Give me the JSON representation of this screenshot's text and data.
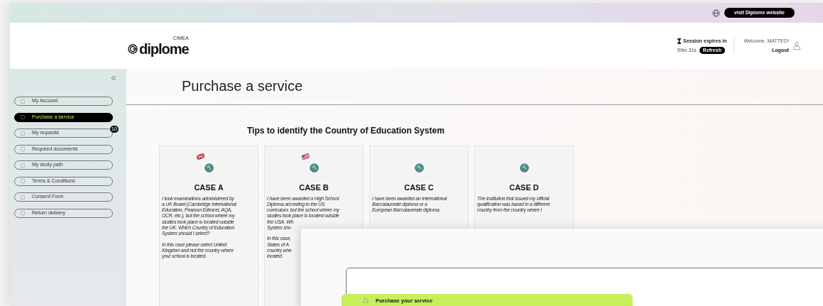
{
  "top_bar": {
    "visit_button": "visit Diplome website"
  },
  "header": {
    "logo": {
      "brand": "diplome",
      "super": "CIMEA"
    },
    "session": {
      "label": "Session expires in",
      "time": "59m 31s",
      "refresh": "Refresh"
    },
    "user": {
      "welcome": "Welcome, MATTEO!",
      "logout": "Logout"
    }
  },
  "sidebar": {
    "items": [
      {
        "label": "My Account",
        "selected": false
      },
      {
        "label": "Purchase a service",
        "selected": true
      },
      {
        "label": "My requests",
        "selected": false,
        "badge": "10"
      },
      {
        "label": "Required documents",
        "selected": false
      },
      {
        "label": "My study path",
        "selected": false
      },
      {
        "label": "Terms & Conditions",
        "selected": false
      },
      {
        "label": "Consent Form",
        "selected": false
      },
      {
        "label": "Return delivery",
        "selected": false
      }
    ]
  },
  "page": {
    "title": "Purchase a service",
    "subtitle": "Tips to identify the Country of Education System",
    "cards": [
      {
        "title": "CASE A",
        "kind": "uk",
        "paragraphs": [
          [
            "I took examinations administered by",
            "a UK Board (Cambridge International",
            "Education, Pearson Edexcel, AQA,",
            "OCR, etc.), but the school where my",
            "studies took place is located outside",
            "the UK. Which Country of Education",
            "System should I select?"
          ],
          [
            "In this case please select United",
            "Kingdom and not the country where",
            "your school is located."
          ]
        ]
      },
      {
        "title": "CASE B",
        "kind": "us",
        "paragraphs": [
          [
            "I have been awarded a High School",
            "Diploma according to the US",
            "curriculum, but the school where my",
            "studies took place is located outside",
            "the USA. Wh",
            "System sho"
          ],
          [
            "In this case,",
            "States of A",
            "country whe",
            "located."
          ]
        ]
      },
      {
        "title": "CASE C",
        "paragraphs": [
          [
            "I have been awarded an International",
            "Baccalaureate diploma or a",
            "European Baccalaureate diploma."
          ]
        ]
      },
      {
        "title": "CASE D",
        "paragraphs": [
          [
            "The institution that issued my official",
            "qualification was based in a different",
            "country from the country where I"
          ]
        ]
      }
    ]
  },
  "overlay": {
    "step": "Purchase your service"
  }
}
